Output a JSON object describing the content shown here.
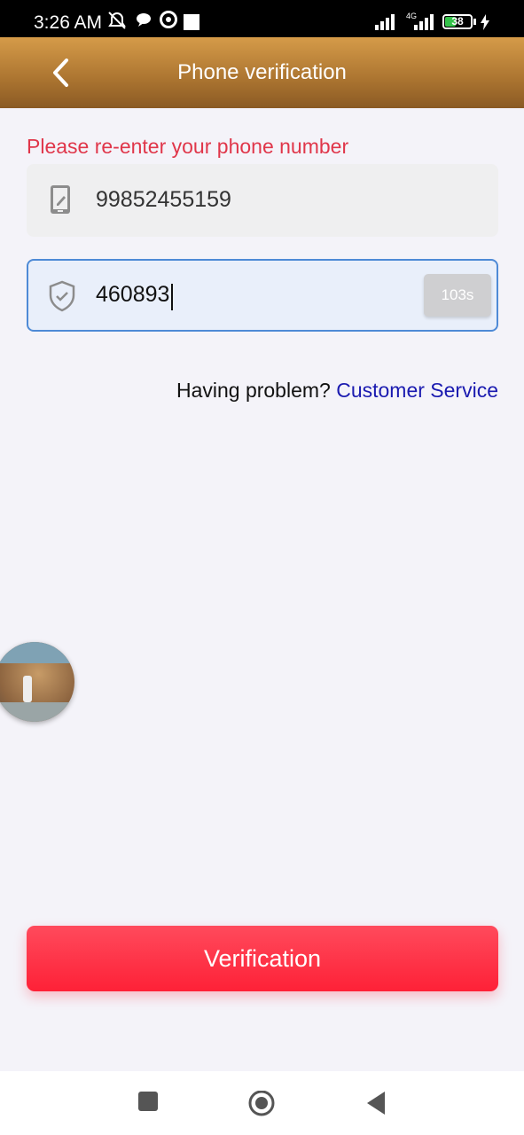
{
  "status_bar": {
    "time": "3:26 AM",
    "network": "4G",
    "battery": "38"
  },
  "header": {
    "title": "Phone verification"
  },
  "form": {
    "hint": "Please re-enter your phone number",
    "phone_value": "99852455159",
    "code_value": "460893",
    "countdown": "103s"
  },
  "help": {
    "text": "Having problem? ",
    "link": "Customer Service"
  },
  "verify_button": "Verification",
  "colors": {
    "header": "#ab7430",
    "hint": "#e0364a",
    "link": "#1a1ab0",
    "button": "#fe2137",
    "field_border": "#4e8ad6"
  }
}
